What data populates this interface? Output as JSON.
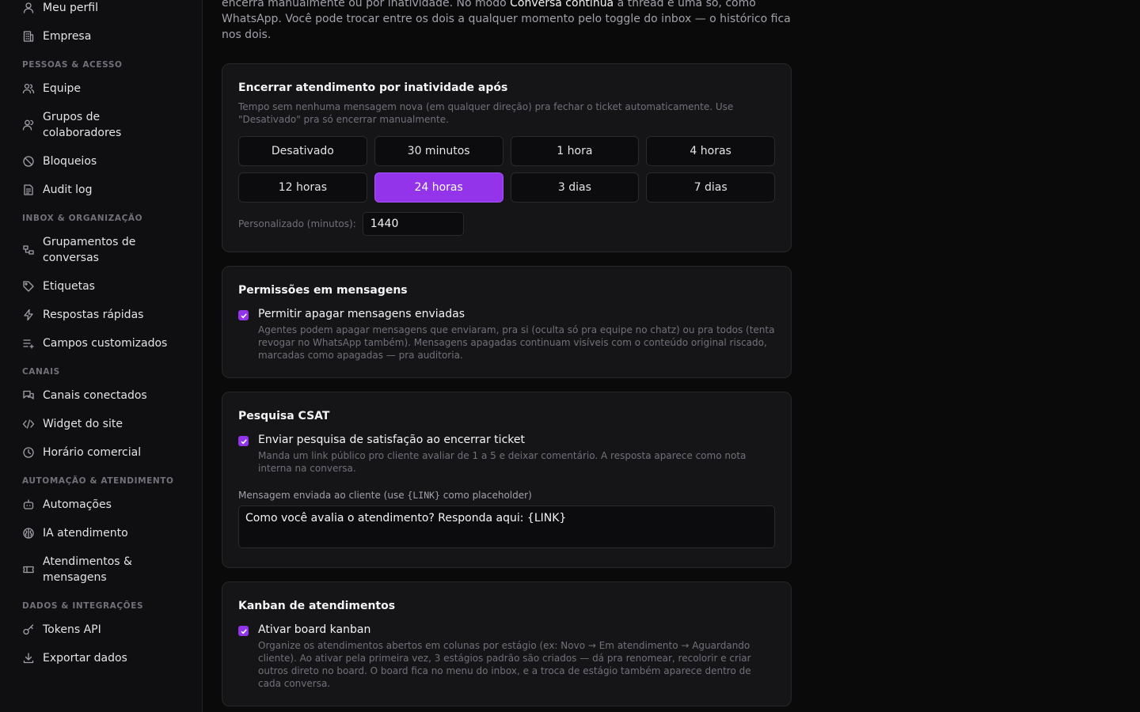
{
  "sidebar": {
    "top_items": [
      {
        "label": "Meu perfil",
        "icon": "user-icon"
      },
      {
        "label": "Empresa",
        "icon": "building-icon"
      }
    ],
    "sections": [
      {
        "title": "PESSOAS & ACESSO",
        "items": [
          {
            "label": "Equipe",
            "icon": "users-icon"
          },
          {
            "label": "Grupos de colaboradores",
            "icon": "user-group-icon"
          },
          {
            "label": "Bloqueios",
            "icon": "ban-icon"
          },
          {
            "label": "Audit log",
            "icon": "audit-log-icon"
          }
        ]
      },
      {
        "title": "INBOX & ORGANIZAÇÃO",
        "items": [
          {
            "label": "Grupamentos de conversas",
            "icon": "grouping-icon"
          },
          {
            "label": "Etiquetas",
            "icon": "tag-icon"
          },
          {
            "label": "Respostas rápidas",
            "icon": "zap-icon"
          },
          {
            "label": "Campos customizados",
            "icon": "list-plus-icon"
          }
        ]
      },
      {
        "title": "CANAIS",
        "items": [
          {
            "label": "Canais conectados",
            "icon": "chat-bubbles-icon"
          },
          {
            "label": "Widget do site",
            "icon": "code-icon"
          },
          {
            "label": "Horário comercial",
            "icon": "clock-icon"
          }
        ]
      },
      {
        "title": "AUTOMAÇÃO & ATENDIMENTO",
        "items": [
          {
            "label": "Automações",
            "icon": "bot-icon"
          },
          {
            "label": "IA atendimento",
            "icon": "brain-icon"
          },
          {
            "label": "Atendimentos & mensagens",
            "icon": "ticket-icon"
          }
        ]
      },
      {
        "title": "DADOS & INTEGRAÇÕES",
        "items": [
          {
            "label": "Tokens API",
            "icon": "key-icon"
          },
          {
            "label": "Exportar dados",
            "icon": "download-icon"
          }
        ]
      }
    ]
  },
  "intro": {
    "line1_start": "encerra manualmente ou por inatividade. No modo ",
    "highlight": "Conversa contínua",
    "line1_end": " a thread é uma só, como",
    "rest": "WhatsApp. Você pode trocar entre os dois a qualquer momento pelo toggle do inbox — o histórico fica nos dois."
  },
  "inactivity": {
    "title": "Encerrar atendimento por inatividade após",
    "description": "Tempo sem nenhuma mensagem nova (em qualquer direção) pra fechar o ticket automaticamente. Use \"Desativado\" pra só encerrar manualmente.",
    "options": [
      "Desativado",
      "30 minutos",
      "1 hora",
      "4 horas",
      "12 horas",
      "24 horas",
      "3 dias",
      "7 dias"
    ],
    "selected": "24 horas",
    "custom_label": "Personalizado (minutos):",
    "custom_value": "1440"
  },
  "permissions": {
    "title": "Permissões em mensagens",
    "checkbox_label": "Permitir apagar mensagens enviadas",
    "checked": true,
    "description": "Agentes podem apagar mensagens que enviaram, pra si (oculta só pra equipe no chatz) ou pra todos (tenta revogar no WhatsApp também). Mensagens apagadas continuam visíveis com o conteúdo original riscado, marcadas como apagadas — pra auditoria."
  },
  "csat": {
    "title": "Pesquisa CSAT",
    "checkbox_label": "Enviar pesquisa de satisfação ao encerrar ticket",
    "checked": true,
    "description": "Manda um link público pro cliente avaliar de 1 a 5 e deixar comentário. A resposta aparece como nota interna na conversa.",
    "field_label_start": "Mensagem enviada ao cliente (use ",
    "field_label_code": "{LINK}",
    "field_label_end": " como placeholder)",
    "message_value": "Como você avalia o atendimento? Responda aqui: {LINK}"
  },
  "kanban": {
    "title": "Kanban de atendimentos",
    "checkbox_label": "Ativar board kanban",
    "checked": true,
    "description": "Organize os atendimentos abertos em colunas por estágio (ex: Novo → Em atendimento → Aguardando cliente). Ao ativar pela primeira vez, 3 estágios padrão são criados — dá pra renomear, recolorir e criar outros direto no board. O board fica no menu do inbox, e a troca de estágio também aparece dentro de cada conversa."
  },
  "colors": {
    "accent": "#9333ea",
    "background": "#0a0a0b",
    "card": "#151518"
  }
}
